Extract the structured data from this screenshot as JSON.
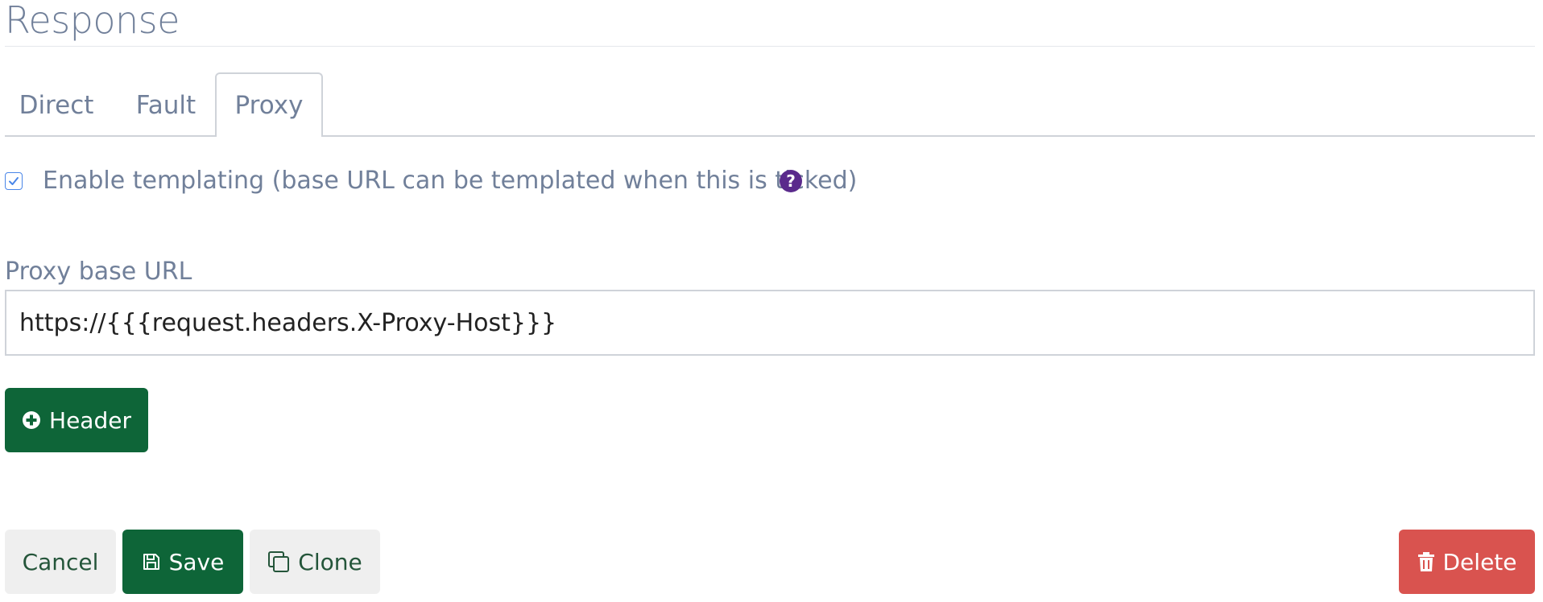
{
  "section": {
    "title": "Response"
  },
  "tabs": [
    {
      "label": "Direct",
      "active": false
    },
    {
      "label": "Fault",
      "active": false
    },
    {
      "label": "Proxy",
      "active": true
    }
  ],
  "templating": {
    "label": "Enable templating (base URL can be templated when this is ticked)",
    "checked": true,
    "help_icon": "question-circle-icon",
    "help_glyph": "?"
  },
  "proxy": {
    "label": "Proxy base URL",
    "value": "https://{{{request.headers.X-Proxy-Host}}}"
  },
  "buttons": {
    "header": "Header",
    "cancel": "Cancel",
    "save": "Save",
    "clone": "Clone",
    "delete": "Delete"
  },
  "colors": {
    "primary": "#0e6538",
    "danger": "#d9534f",
    "secondary_bg": "#efefef",
    "help_icon": "#5a2a8c",
    "text_muted": "#71809a"
  }
}
